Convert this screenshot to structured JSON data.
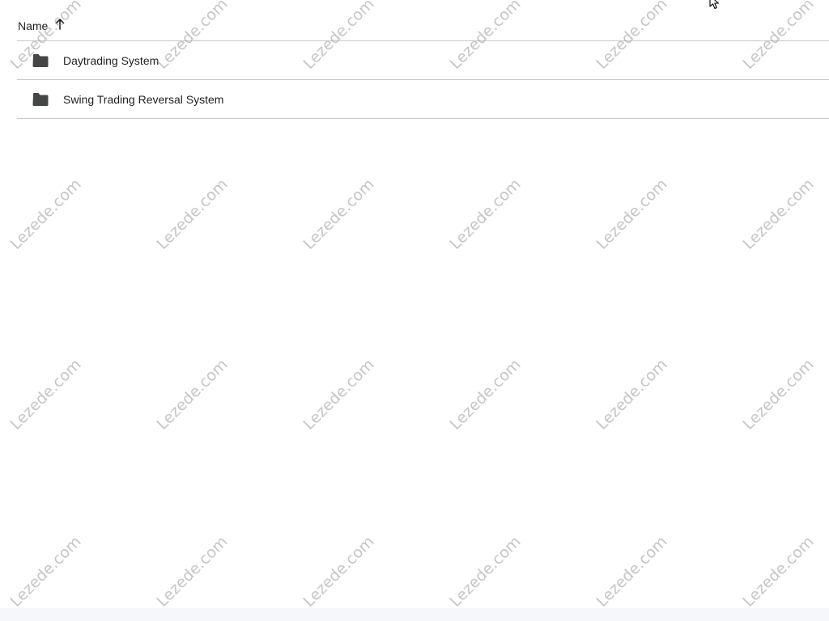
{
  "header": {
    "sort_column_label": "Name",
    "sort_direction_icon": "arrow-up-icon"
  },
  "rows": [
    {
      "label": "Daytrading System",
      "icon": "folder-icon"
    },
    {
      "label": "Swing Trading Reversal System",
      "icon": "folder-icon"
    }
  ],
  "watermark": {
    "text": "Lezede.com"
  },
  "colors": {
    "text": "#1f1f1f",
    "divider": "#c7c7c7",
    "icon": "#444746"
  }
}
